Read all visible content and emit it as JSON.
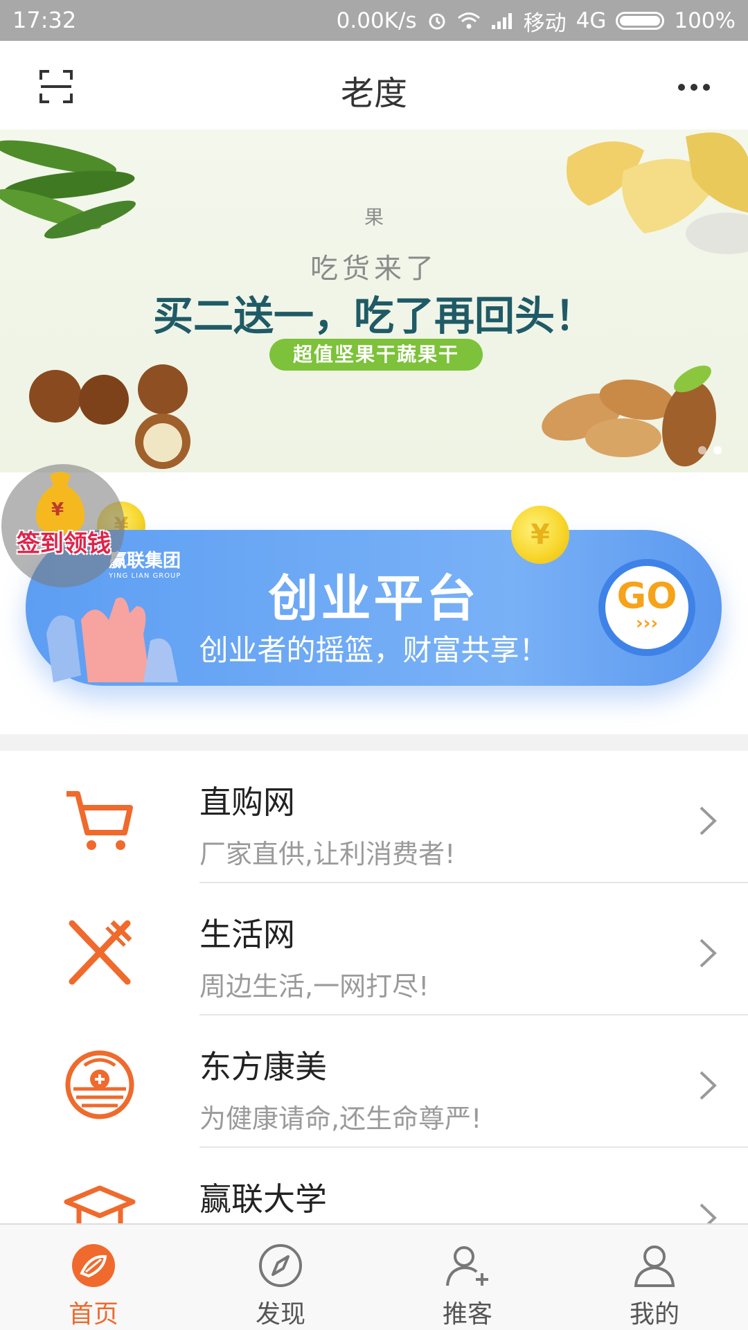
{
  "status_bar": {
    "time": "17:32",
    "net_speed": "0.00K/s",
    "carrier": "移动",
    "network": "4G",
    "battery": "100%"
  },
  "header": {
    "title": "老度"
  },
  "banner": {
    "kicker": "果",
    "subtitle": "吃货来了",
    "headline": "买二送一，吃了再回头！",
    "pill": "超值坚果干蔬果干"
  },
  "checkin": {
    "label": "签到领钱"
  },
  "promo": {
    "brand": "赢联集团",
    "brand_en": "YING LIAN GROUP",
    "title": "创业平台",
    "slogan": "创业者的摇篮，财富共享！",
    "go_label": "GO",
    "go_arrows": "›››"
  },
  "list": {
    "items": [
      {
        "name": "直购网",
        "desc": "厂家直供,让利消费者!",
        "icon": "cart-icon"
      },
      {
        "name": "生活网",
        "desc": "周边生活,一网打尽!",
        "icon": "utensils-icon"
      },
      {
        "name": "东方康美",
        "desc": "为健康请命,还生命尊严!",
        "icon": "health-emblem-icon"
      },
      {
        "name": "赢联大学",
        "desc": "",
        "icon": "graduation-cap-icon"
      }
    ]
  },
  "tabbar": {
    "tabs": [
      {
        "label": "首页",
        "icon": "home-icon",
        "active": true
      },
      {
        "label": "发现",
        "icon": "compass-icon",
        "active": false
      },
      {
        "label": "推客",
        "icon": "add-user-icon",
        "active": false
      },
      {
        "label": "我的",
        "icon": "profile-icon",
        "active": false
      }
    ]
  },
  "colors": {
    "accent": "#ef6a2c",
    "promo_blue": "#5d9ef3",
    "status_bar": "#a8a8a8",
    "banner_pill": "#7dc23a"
  }
}
